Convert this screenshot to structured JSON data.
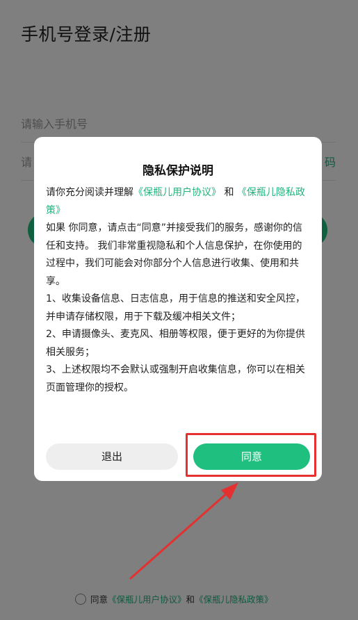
{
  "login": {
    "title": "手机号登录/注册",
    "phone_placeholder": "请输入手机号",
    "code_placeholder": "请",
    "get_code": "码"
  },
  "agreement_row": {
    "prefix": "同意",
    "user_agreement": "《保瓶儿用户协议》",
    "and": "和",
    "privacy_policy": "《保瓶儿隐私政策》"
  },
  "dialog": {
    "title": "隐私保护说明",
    "intro_text": "请你充分阅读并理解",
    "user_agreement_link": "《保瓶儿用户协议》",
    "and": "和",
    "privacy_policy_link": "《保瓶儿隐私政策》",
    "paragraph1": "如果 你同意，请点击“同意”并接受我们的服务，感谢你的信任和支持。 我们非常重视隐私和个人信息保护，在你使用的过程中，我们可能会对你部分个人信息进行收集、使用和共享。",
    "item1": "1、收集设备信息、日志信息，用于信息的推送和安全风控，并申请存储权限，用于下载及缓冲相关文件；",
    "item2": "2、申请摄像头、麦克风、相册等权限，便于更好的为你提供相关服务；",
    "item3": "3、上述权限均不会默认或强制开启收集信息，你可以在相关页面管理你的授权。",
    "exit_label": "退出",
    "agree_label": "同意"
  },
  "colors": {
    "accent_green": "#1fc07f",
    "link_green": "#1fb47d",
    "annotation_red": "#e53030"
  }
}
